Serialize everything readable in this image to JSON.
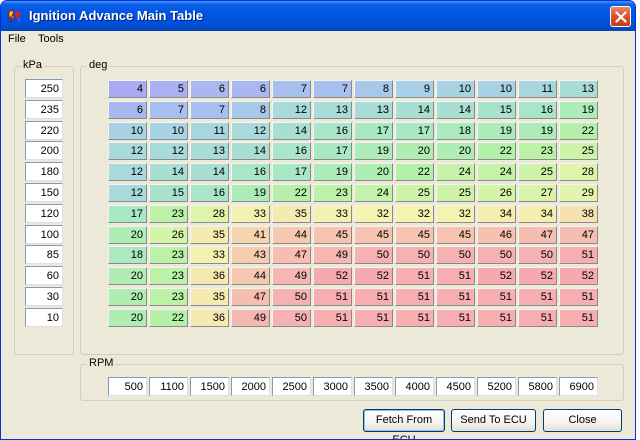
{
  "window": {
    "title": "Ignition Advance Main Table"
  },
  "menu": {
    "file": "File",
    "tools": "Tools"
  },
  "kpa": {
    "label": "kPa",
    "values": [
      "250",
      "235",
      "220",
      "200",
      "180",
      "150",
      "120",
      "100",
      "85",
      "60",
      "30",
      "10"
    ]
  },
  "table": {
    "label": "deg",
    "rows": [
      [
        "4",
        "5",
        "6",
        "6",
        "7",
        "7",
        "8",
        "9",
        "10",
        "10",
        "11",
        "13"
      ],
      [
        "6",
        "7",
        "7",
        "8",
        "12",
        "13",
        "13",
        "14",
        "14",
        "15",
        "16",
        "19"
      ],
      [
        "10",
        "10",
        "11",
        "12",
        "14",
        "16",
        "17",
        "17",
        "18",
        "19",
        "19",
        "22"
      ],
      [
        "12",
        "12",
        "13",
        "14",
        "16",
        "17",
        "19",
        "20",
        "20",
        "22",
        "23",
        "25"
      ],
      [
        "12",
        "14",
        "14",
        "16",
        "17",
        "19",
        "20",
        "22",
        "24",
        "24",
        "25",
        "28"
      ],
      [
        "12",
        "15",
        "16",
        "19",
        "22",
        "23",
        "24",
        "25",
        "25",
        "26",
        "27",
        "29"
      ],
      [
        "17",
        "23",
        "28",
        "33",
        "35",
        "33",
        "32",
        "32",
        "32",
        "34",
        "34",
        "38"
      ],
      [
        "20",
        "26",
        "35",
        "41",
        "44",
        "45",
        "45",
        "45",
        "45",
        "46",
        "47",
        "47"
      ],
      [
        "18",
        "23",
        "33",
        "43",
        "47",
        "49",
        "50",
        "50",
        "50",
        "50",
        "50",
        "51"
      ],
      [
        "20",
        "23",
        "36",
        "44",
        "49",
        "52",
        "52",
        "51",
        "51",
        "52",
        "52",
        "52"
      ],
      [
        "20",
        "23",
        "35",
        "47",
        "50",
        "51",
        "51",
        "51",
        "51",
        "51",
        "51",
        "51"
      ],
      [
        "20",
        "22",
        "36",
        "49",
        "50",
        "51",
        "51",
        "51",
        "51",
        "51",
        "51",
        "51"
      ]
    ]
  },
  "rpm": {
    "label": "RPM",
    "values": [
      "500",
      "1100",
      "1500",
      "2000",
      "2500",
      "3000",
      "3500",
      "4000",
      "4500",
      "5200",
      "5800",
      "6900"
    ]
  },
  "buttons": {
    "fetch": "Fetch From ECU",
    "send": "Send To ECU",
    "close": "Close"
  },
  "colors": {
    "titlebar": "#0054e3",
    "window_bg": "#ece9d8",
    "cold": "#a9a9f4",
    "cool": "#a8d0e0",
    "mild": "#a8ecb8",
    "warm": "#f4f4b0",
    "hot": "#f5b0b0"
  },
  "icons": {
    "app": "app-logo-icon",
    "close": "close-x-icon"
  }
}
